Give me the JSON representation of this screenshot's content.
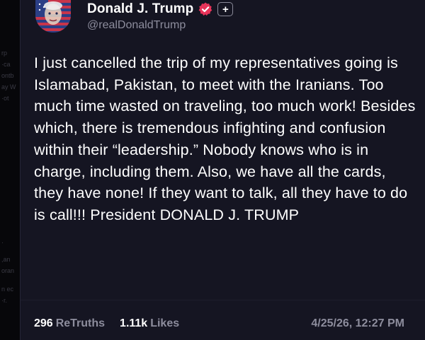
{
  "post": {
    "author_name": "Donald J. Trump",
    "handle": "@realDonaldTrump",
    "text": "I just cancelled the trip of my representatives going is Islamabad, Pakistan, to meet with the Iranians. Too much time wasted on traveling, too much work! Besides which, there is tremendous infighting and confusion within their “leadership.” Nobody knows who is in charge, including them. Also, we have all the cards, they have none! If they want to talk, all they have to do is call!!! President DONALD J. TRUMP",
    "retruths_count": "296",
    "retruths_label": "ReTruths",
    "likes_count": "1.11k",
    "likes_label": "Likes",
    "timestamp": "4/25/26, 12:27 PM"
  },
  "icons": {
    "verified": "verified-badge-icon",
    "plus": "plus-badge-icon"
  },
  "colors": {
    "background": "#151522",
    "page": "#0b0b0f",
    "text": "#ffffff",
    "muted": "#8d8d9d",
    "verified": "#e8345a"
  }
}
